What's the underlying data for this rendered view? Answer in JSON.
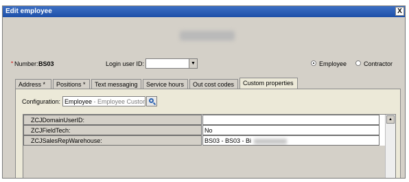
{
  "window": {
    "title": "Edit employee",
    "close_glyph": "X"
  },
  "header": {
    "number_label": "Number:",
    "number_value": "BS03",
    "login_label": "Login user ID:",
    "login_value": ""
  },
  "type_options": [
    {
      "label": "Employee",
      "selected": true
    },
    {
      "label": "Contractor",
      "selected": false
    }
  ],
  "tabs": [
    {
      "label": "Address *"
    },
    {
      "label": "Positions *"
    },
    {
      "label": "Text messaging"
    },
    {
      "label": "Service hours"
    },
    {
      "label": "Out cost codes"
    },
    {
      "label": "Custom properties",
      "active": true
    }
  ],
  "configuration": {
    "label": "Configuration:",
    "value": "Employee",
    "sub": " - Employee Custom Pr"
  },
  "properties": [
    {
      "name": "ZCJDomainUserID:",
      "value": ""
    },
    {
      "name": "ZCJFieldTech:",
      "value": "No"
    },
    {
      "name": "ZCJSalesRepWarehouse:",
      "value": "BS03 - BS03 - Bi"
    }
  ]
}
